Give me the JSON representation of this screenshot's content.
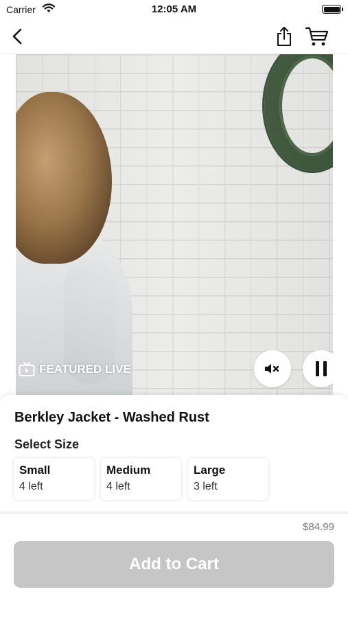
{
  "status_bar": {
    "carrier": "Carrier",
    "time": "12:05 AM"
  },
  "nav": {
    "icons": [
      "chevron-left-icon",
      "share-icon",
      "cart-icon"
    ]
  },
  "video": {
    "badge_label": "FEATURED LIVE",
    "icons": [
      "tv-icon",
      "mute-icon",
      "pause-icon"
    ]
  },
  "product": {
    "title": "Berkley Jacket - Washed Rust",
    "size_label": "Select Size",
    "sizes": [
      {
        "name": "Small",
        "stock": "4 left"
      },
      {
        "name": "Medium",
        "stock": "4 left"
      },
      {
        "name": "Large",
        "stock": "3 left"
      }
    ],
    "price": "$84.99",
    "add_to_cart_label": "Add to Cart"
  },
  "colors": {
    "button_disabled": "#c6c6c6",
    "price_text": "#777777"
  }
}
